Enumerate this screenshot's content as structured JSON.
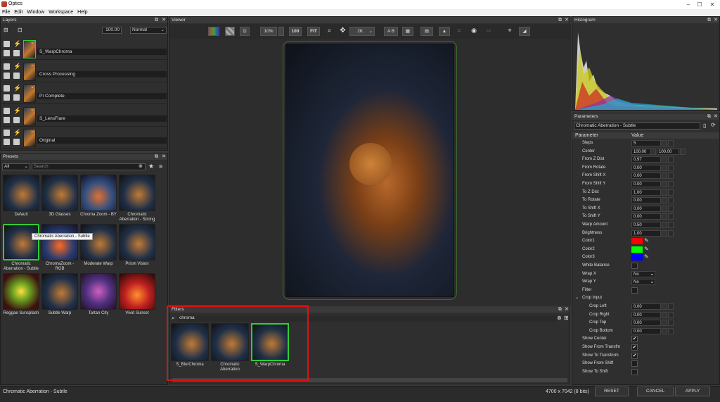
{
  "app": {
    "title": "Optics"
  },
  "menu": [
    "File",
    "Edit",
    "Window",
    "Workspace",
    "Help"
  ],
  "layers_panel": {
    "title": "Layers",
    "opacity": "100.00",
    "blend": "Normal",
    "items": [
      "S_WarpChroma",
      "Cross Processing",
      "PI Complete",
      "S_LensFlare",
      "Original"
    ]
  },
  "presets_panel": {
    "title": "Presets",
    "filter": "All",
    "search_placeholder": "Search",
    "tooltip": "Chromatic Aberration - Subtle",
    "items": [
      "Default",
      "3D Glasses",
      "Chroma Zoom - BY",
      "Chromatic Aberration - Strong",
      "Chromatic Aberration - Subtle",
      "ChromaZoom - RGB",
      "Moderate Warp",
      "Prism Vision",
      "Reggae Sunsplash",
      "Subtle Warp",
      "Tartan City",
      "Vivid Sunset"
    ]
  },
  "viewer": {
    "title": "Viewer",
    "zoom": "10%",
    "zoom_100": "100",
    "fit": "FIT",
    "resolution": "2K",
    "ab": "A B"
  },
  "filters_panel": {
    "title": "Filters",
    "search": "chroma",
    "items": [
      "S_BlurChroma",
      "Chromatic Aberration",
      "S_WarpChroma"
    ]
  },
  "histogram": {
    "title": "Histogram"
  },
  "parameters": {
    "title": "Parameters",
    "preset": "Chromatic Aberration - Subtle",
    "col_param": "Parameter",
    "col_value": "Value",
    "rows": [
      {
        "name": "Steps",
        "value": "5"
      },
      {
        "name": "Center",
        "value": "100.00",
        "value2": "100.00"
      },
      {
        "name": "From Z Dist",
        "value": "0.97"
      },
      {
        "name": "From Rotate",
        "value": "0.00"
      },
      {
        "name": "From Shift X",
        "value": "0.00"
      },
      {
        "name": "From Shift Y",
        "value": "0.00"
      },
      {
        "name": "To Z Dist",
        "value": "1.00"
      },
      {
        "name": "To Rotate",
        "value": "0.00"
      },
      {
        "name": "To Shift X",
        "value": "0.00"
      },
      {
        "name": "To Shift Y",
        "value": "0.00"
      },
      {
        "name": "Warp Amount",
        "value": "0.50"
      },
      {
        "name": "Brightness",
        "value": "1.00"
      },
      {
        "name": "Color1",
        "color": "#ff0000"
      },
      {
        "name": "Color2",
        "color": "#00ff00"
      },
      {
        "name": "Color3",
        "color": "#0000ff"
      },
      {
        "name": "White Balance",
        "check": ""
      },
      {
        "name": "Wrap X",
        "value": "No"
      },
      {
        "name": "Wrap Y",
        "value": "No"
      },
      {
        "name": "Filter",
        "check": ""
      },
      {
        "name": "Crop Input",
        "group": "true"
      },
      {
        "name": "Crop Left",
        "value": "0.00",
        "indent": "true"
      },
      {
        "name": "Crop Right",
        "value": "0.00",
        "indent": "true"
      },
      {
        "name": "Crop Top",
        "value": "0.00",
        "indent": "true"
      },
      {
        "name": "Crop Bottom",
        "value": "0.00",
        "indent": "true"
      },
      {
        "name": "Show Center",
        "check": "✔"
      },
      {
        "name": "Show From Transfm",
        "check": "✔"
      },
      {
        "name": "Show To Transform",
        "check": "✔"
      },
      {
        "name": "Show From Shift",
        "check": ""
      },
      {
        "name": "Show To Shift",
        "check": ""
      }
    ]
  },
  "status": {
    "left": "Chromatic Aberration - Subtle",
    "dims": "4700 x 7042 (8 bits)",
    "reset": "RESET",
    "cancel": "CANCEL",
    "apply": "APPLY"
  }
}
